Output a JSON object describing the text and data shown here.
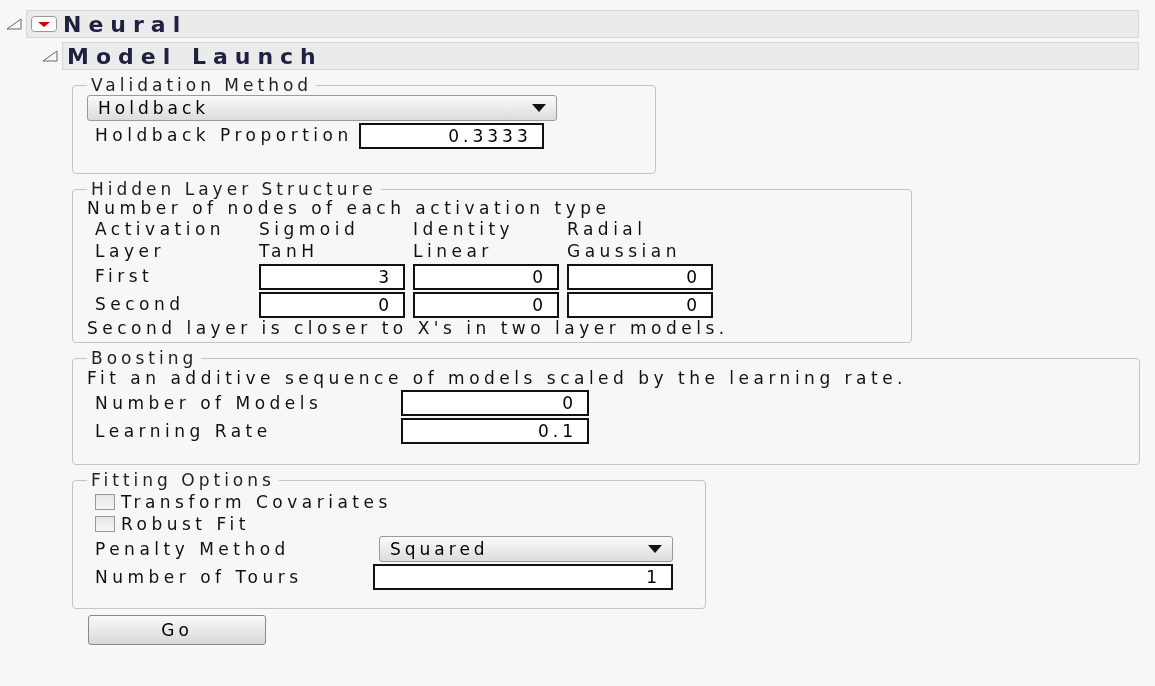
{
  "outline": {
    "title": "Neural",
    "expanded": true,
    "menu_icon": true,
    "child": {
      "title": "Model Launch",
      "expanded": true,
      "groups": [
        {
          "kind": "validation",
          "legend": "Validation Method",
          "dropdown": "Holdback",
          "field_label": "Holdback Proportion",
          "field_value": "0.3333"
        },
        {
          "kind": "hidden",
          "legend": "Hidden Layer Structure",
          "intro": "Number of nodes of each activation type",
          "header_rows": [
            [
              "Activation",
              "Sigmoid",
              "Identity",
              "Radial"
            ],
            [
              "Layer",
              "TanH",
              "Linear",
              "Gaussian"
            ]
          ],
          "rows": [
            {
              "label": "First",
              "values": [
                "3",
                "0",
                "0"
              ]
            },
            {
              "label": "Second",
              "values": [
                "0",
                "0",
                "0"
              ]
            }
          ],
          "note": "Second layer is closer to X's in two layer models."
        },
        {
          "kind": "boosting",
          "legend": "Boosting",
          "intro": "Fit an additive sequence of models scaled by the learning rate.",
          "fields": [
            {
              "label": "Number of Models",
              "value": "0"
            },
            {
              "label": "Learning Rate",
              "value": "0.1"
            }
          ]
        },
        {
          "kind": "fitting",
          "legend": "Fitting Options",
          "checkboxes": [
            {
              "label": "Transform Covariates",
              "checked": false
            },
            {
              "label": "Robust Fit",
              "checked": false
            }
          ],
          "dropdown_label": "Penalty Method",
          "dropdown": "Squared",
          "field_label": "Number of Tours",
          "field_value": "1"
        }
      ],
      "button": "Go"
    }
  }
}
